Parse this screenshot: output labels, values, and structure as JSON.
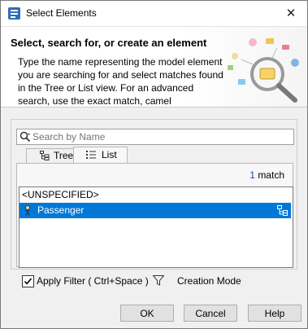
{
  "window": {
    "title": "Select Elements",
    "close_glyph": "✕"
  },
  "header": {
    "title": "Select, search for, or create an element",
    "description": "Type the name representing the model element you are searching for and select matches found in the Tree or List view. For an advanced search, use the exact match, camel"
  },
  "search": {
    "placeholder": "Search by Name",
    "value": ""
  },
  "tabs": [
    {
      "label": "Tree",
      "icon": "tree-icon",
      "selected": false
    },
    {
      "label": "List",
      "icon": "list-icon",
      "selected": true
    }
  ],
  "results": {
    "match_count": "1",
    "match_suffix": "match",
    "items": [
      {
        "label": "<UNSPECIFIED>",
        "selected": false
      },
      {
        "label": "Passenger",
        "icon": "actor-icon",
        "selected": true
      }
    ]
  },
  "options": {
    "apply_filter": {
      "label": "Apply Filter ( Ctrl+Space )",
      "checked": true
    },
    "creation_mode_label": "Creation Mode"
  },
  "buttons": {
    "ok": "OK",
    "cancel": "Cancel",
    "help": "Help"
  },
  "colors": {
    "selection": "#0078d7",
    "match_number": "#1a4aa0"
  }
}
